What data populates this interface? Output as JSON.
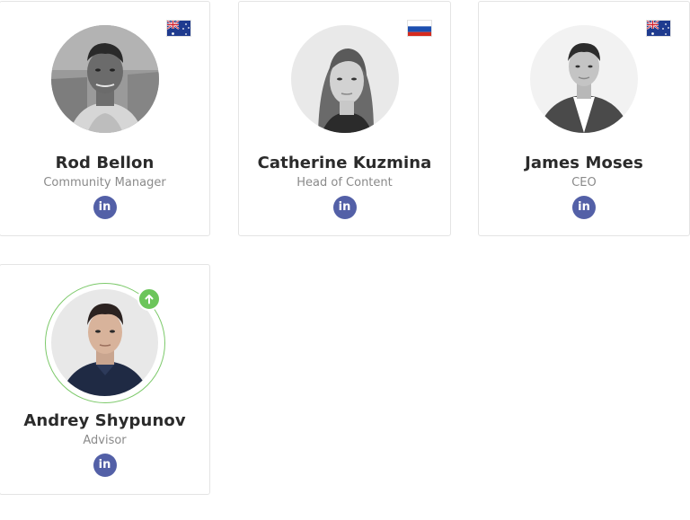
{
  "team": [
    {
      "name": "Rod Bellon",
      "role": "Community Manager",
      "flag": "australia-flag",
      "photo": "rod-bellon-photo",
      "social": "linkedin-icon",
      "social_label": "in"
    },
    {
      "name": "Catherine Kuzmina",
      "role": "Head of Content",
      "flag": "russia-flag",
      "photo": "catherine-kuzmina-photo",
      "social": "linkedin-icon",
      "social_label": "in"
    },
    {
      "name": "James Moses",
      "role": "CEO",
      "flag": "australia-flag",
      "photo": "james-moses-photo",
      "social": "linkedin-icon",
      "social_label": "in"
    },
    {
      "name": "Andrey Shypunov",
      "role": "Advisor",
      "badge": "arrow-up-badge",
      "photo": "andrey-shypunov-photo",
      "social": "linkedin-icon",
      "social_label": "in"
    }
  ],
  "colors": {
    "linkedin": "#5360a7",
    "badge_green": "#6cc55b",
    "card_border": "#e4e4e4",
    "name_text": "#2b2b2b",
    "role_text": "#8a8a8a"
  }
}
